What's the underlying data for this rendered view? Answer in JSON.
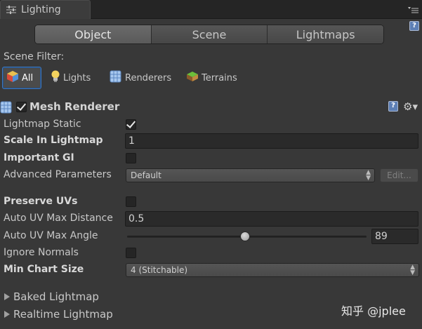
{
  "window": {
    "tab_title": "Lighting"
  },
  "mode_tabs": [
    {
      "label": "Object",
      "active": true
    },
    {
      "label": "Scene",
      "active": false
    },
    {
      "label": "Lightmaps",
      "active": false
    }
  ],
  "scene_filter": {
    "label": "Scene Filter:",
    "items": [
      {
        "label": "All",
        "icon": "cube-icon",
        "selected": true
      },
      {
        "label": "Lights",
        "icon": "lightbulb-icon",
        "selected": false
      },
      {
        "label": "Renderers",
        "icon": "renderer-grid-icon",
        "selected": false
      },
      {
        "label": "Terrains",
        "icon": "terrain-icon",
        "selected": false
      }
    ]
  },
  "mesh_renderer": {
    "title": "Mesh Renderer",
    "enabled": true,
    "help_icon": "?",
    "gear_icon": "⚙▾",
    "lightmap_static": {
      "label": "Lightmap Static",
      "checked": true
    },
    "scale_in_lightmap": {
      "label": "Scale In Lightmap",
      "value": "1"
    },
    "important_gi": {
      "label": "Important GI",
      "checked": false
    },
    "advanced_parameters": {
      "label": "Advanced Parameters",
      "value": "Default",
      "edit_label": "Edit..."
    },
    "preserve_uvs": {
      "label": "Preserve UVs",
      "checked": false
    },
    "auto_uv_max_distance": {
      "label": "Auto UV Max Distance",
      "value": "0.5"
    },
    "auto_uv_max_angle": {
      "label": "Auto UV Max Angle",
      "value": "89",
      "slider_fraction": 0.494
    },
    "ignore_normals": {
      "label": "Ignore Normals",
      "checked": false
    },
    "min_chart_size": {
      "label": "Min Chart Size",
      "value": "4 (Stitchable)"
    }
  },
  "foldouts": [
    {
      "label": "Baked Lightmap"
    },
    {
      "label": "Realtime Lightmap"
    }
  ],
  "watermark": "知乎 @jplee",
  "colors": {
    "accent_selection": "#3b78c0",
    "background": "#383838"
  }
}
